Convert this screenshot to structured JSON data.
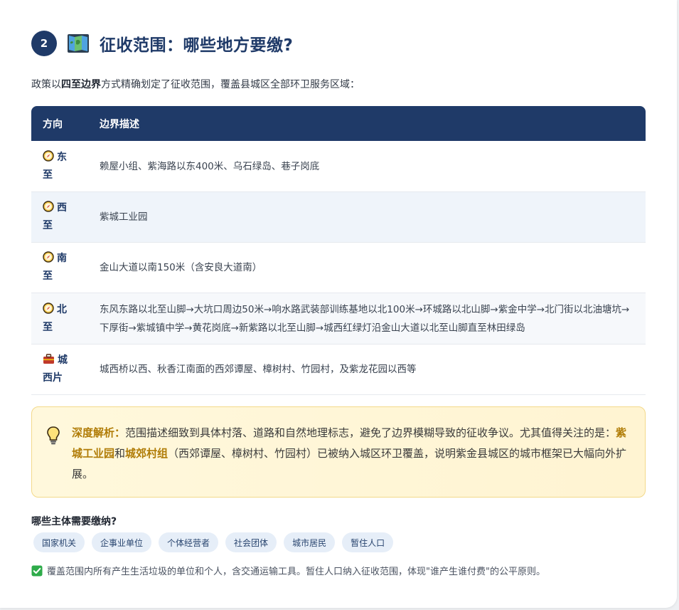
{
  "section": {
    "number": "2",
    "icon": "map-icon",
    "title": "征收范围：哪些地方要缴?"
  },
  "intro": {
    "prefix": "政策以",
    "emphasis": "四至边界",
    "suffix": "方式精确划定了征收范围，覆盖县城区全部环卫服务区域："
  },
  "table": {
    "headers": [
      "方向",
      "边界描述"
    ],
    "rows": [
      {
        "icon": "compass-icon",
        "direction": "东至",
        "desc": "赖屋小组、紫海路以东400米、乌石绿岛、巷子岗底"
      },
      {
        "icon": "compass-icon",
        "direction": "西至",
        "desc": "紫城工业园"
      },
      {
        "icon": "compass-icon",
        "direction": "南至",
        "desc": "金山大道以南150米（含安良大道南）"
      },
      {
        "icon": "compass-icon",
        "direction": "北至",
        "desc": "东风东路以北至山脚→大坑口周边50米→响水路武装部训练基地以北100米→环城路以北山脚→紫金中学→北门街以北油塘坑→下厚街→紫城镇中学→黄花岗底→新紫路以北至山脚→城西红绿灯沿金山大道以北至山脚直至林田绿岛"
      },
      {
        "icon": "bag-icon",
        "direction": "城西片",
        "desc": "城西桥以西、秋香江南面的西郊谭屋、樟树村、竹园村，及紫龙花园以西等"
      }
    ]
  },
  "tip": {
    "icon": "lightbulb-icon",
    "lead": "深度解析：",
    "text1": "范围描述细致到具体村落、道路和自然地理标志，避免了边界模糊导致的征收争议。尤其值得关注的是：",
    "hl1": "紫城工业园",
    "and": "和",
    "hl2": "城郊村组",
    "text2": "（西郊谭屋、樟树村、竹园村）已被纳入城区环卫覆盖，说明紫金县城区的城市框架已大幅向外扩展。"
  },
  "subjects": {
    "title": "哪些主体需要缴纳?",
    "tags": [
      "国家机关",
      "企事业单位",
      "个体经营者",
      "社会团体",
      "城市居民",
      "暂住人口"
    ]
  },
  "note": {
    "icon": "checkmark-icon",
    "text": "覆盖范围内所有产生生活垃圾的单位和个人，含交通运输工具。暂住人口纳入征收范围，体现\"谁产生谁付费\"的公平原则。"
  },
  "colors": {
    "primary": "#1f3a68",
    "accent": "#b07c06",
    "tip_bg": "#fff8dc",
    "tag_bg": "#e6eef8"
  }
}
